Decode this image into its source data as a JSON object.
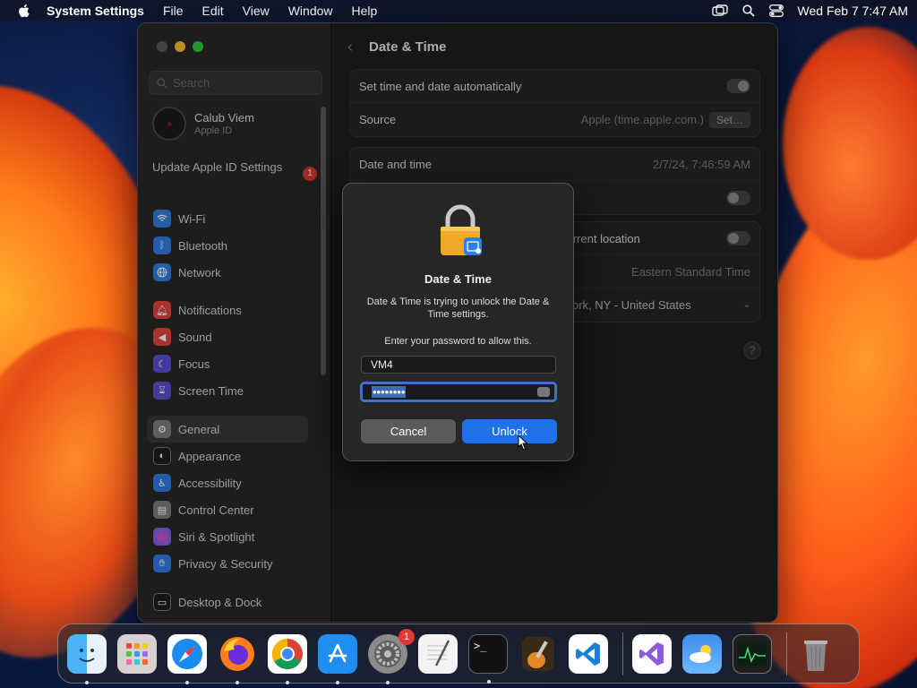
{
  "menubar": {
    "app_name": "System Settings",
    "items": [
      "File",
      "Edit",
      "View",
      "Window",
      "Help"
    ],
    "clock": "Wed Feb 7  7:47 AM"
  },
  "sidebar": {
    "search_placeholder": "Search",
    "user": {
      "name": "Calub Viem",
      "subtitle": "Apple ID"
    },
    "update": {
      "label": "Update Apple ID Settings",
      "badge": "1"
    },
    "groups": [
      [
        {
          "label": "Wi-Fi",
          "icon": "wifi-icon",
          "color": "#2f7de1"
        },
        {
          "label": "Bluetooth",
          "icon": "bluetooth-icon",
          "color": "#2f7de1"
        },
        {
          "label": "Network",
          "icon": "globe-icon",
          "color": "#2f7de1"
        }
      ],
      [
        {
          "label": "Notifications",
          "icon": "bell-icon",
          "color": "#e0453c"
        },
        {
          "label": "Sound",
          "icon": "speaker-icon",
          "color": "#e0453c"
        },
        {
          "label": "Focus",
          "icon": "moon-icon",
          "color": "#5a4fd1"
        },
        {
          "label": "Screen Time",
          "icon": "hourglass-icon",
          "color": "#5a4fd1"
        }
      ],
      [
        {
          "label": "General",
          "icon": "gear-icon",
          "color": "#7d7d7d",
          "active": true
        },
        {
          "label": "Appearance",
          "icon": "appearance-icon",
          "color": "#1c1c1c"
        },
        {
          "label": "Accessibility",
          "icon": "accessibility-icon",
          "color": "#2f7de1"
        },
        {
          "label": "Control Center",
          "icon": "control-center-icon",
          "color": "#7d7d7d"
        },
        {
          "label": "Siri & Spotlight",
          "icon": "siri-icon",
          "color": "#c84cd8"
        },
        {
          "label": "Privacy & Security",
          "icon": "hand-icon",
          "color": "#2f7de1"
        }
      ],
      [
        {
          "label": "Desktop & Dock",
          "icon": "dock-icon",
          "color": "#1c1c1c"
        }
      ]
    ]
  },
  "content": {
    "title": "Date & Time",
    "auto_label": "Set time and date automatically",
    "source_label": "Source",
    "source_value": "Apple (time.apple.com.)",
    "set_button": "Set…",
    "datetime_label": "Date and time",
    "datetime_value": "2/7/24, 7:46:59 AM",
    "location_label": "current location",
    "timezone_value": "Eastern Standard Time",
    "city_value": "ork, NY - United States",
    "help": "?"
  },
  "dialog": {
    "title": "Date & Time",
    "message": "Date & Time is trying to unlock the Date & Time settings.",
    "prompt": "Enter your password to allow this.",
    "username": "VM4",
    "password_mask": "••••••••",
    "cancel": "Cancel",
    "unlock": "Unlock"
  },
  "dock": {
    "apps": [
      {
        "name": "finder",
        "running": true
      },
      {
        "name": "launchpad",
        "running": false
      },
      {
        "name": "safari",
        "running": true
      },
      {
        "name": "firefox",
        "running": true
      },
      {
        "name": "chrome",
        "running": true
      },
      {
        "name": "app-store",
        "running": true
      },
      {
        "name": "system-settings",
        "running": true,
        "badge": "1"
      },
      {
        "name": "textedit",
        "running": false
      },
      {
        "name": "terminal",
        "running": true
      },
      {
        "name": "garageband",
        "running": false
      },
      {
        "name": "vscode",
        "running": false
      },
      {
        "name": "visual-studio",
        "running": false
      },
      {
        "name": "weather",
        "running": false
      },
      {
        "name": "activity-monitor",
        "running": false
      },
      {
        "name": "trash",
        "running": false
      }
    ]
  }
}
